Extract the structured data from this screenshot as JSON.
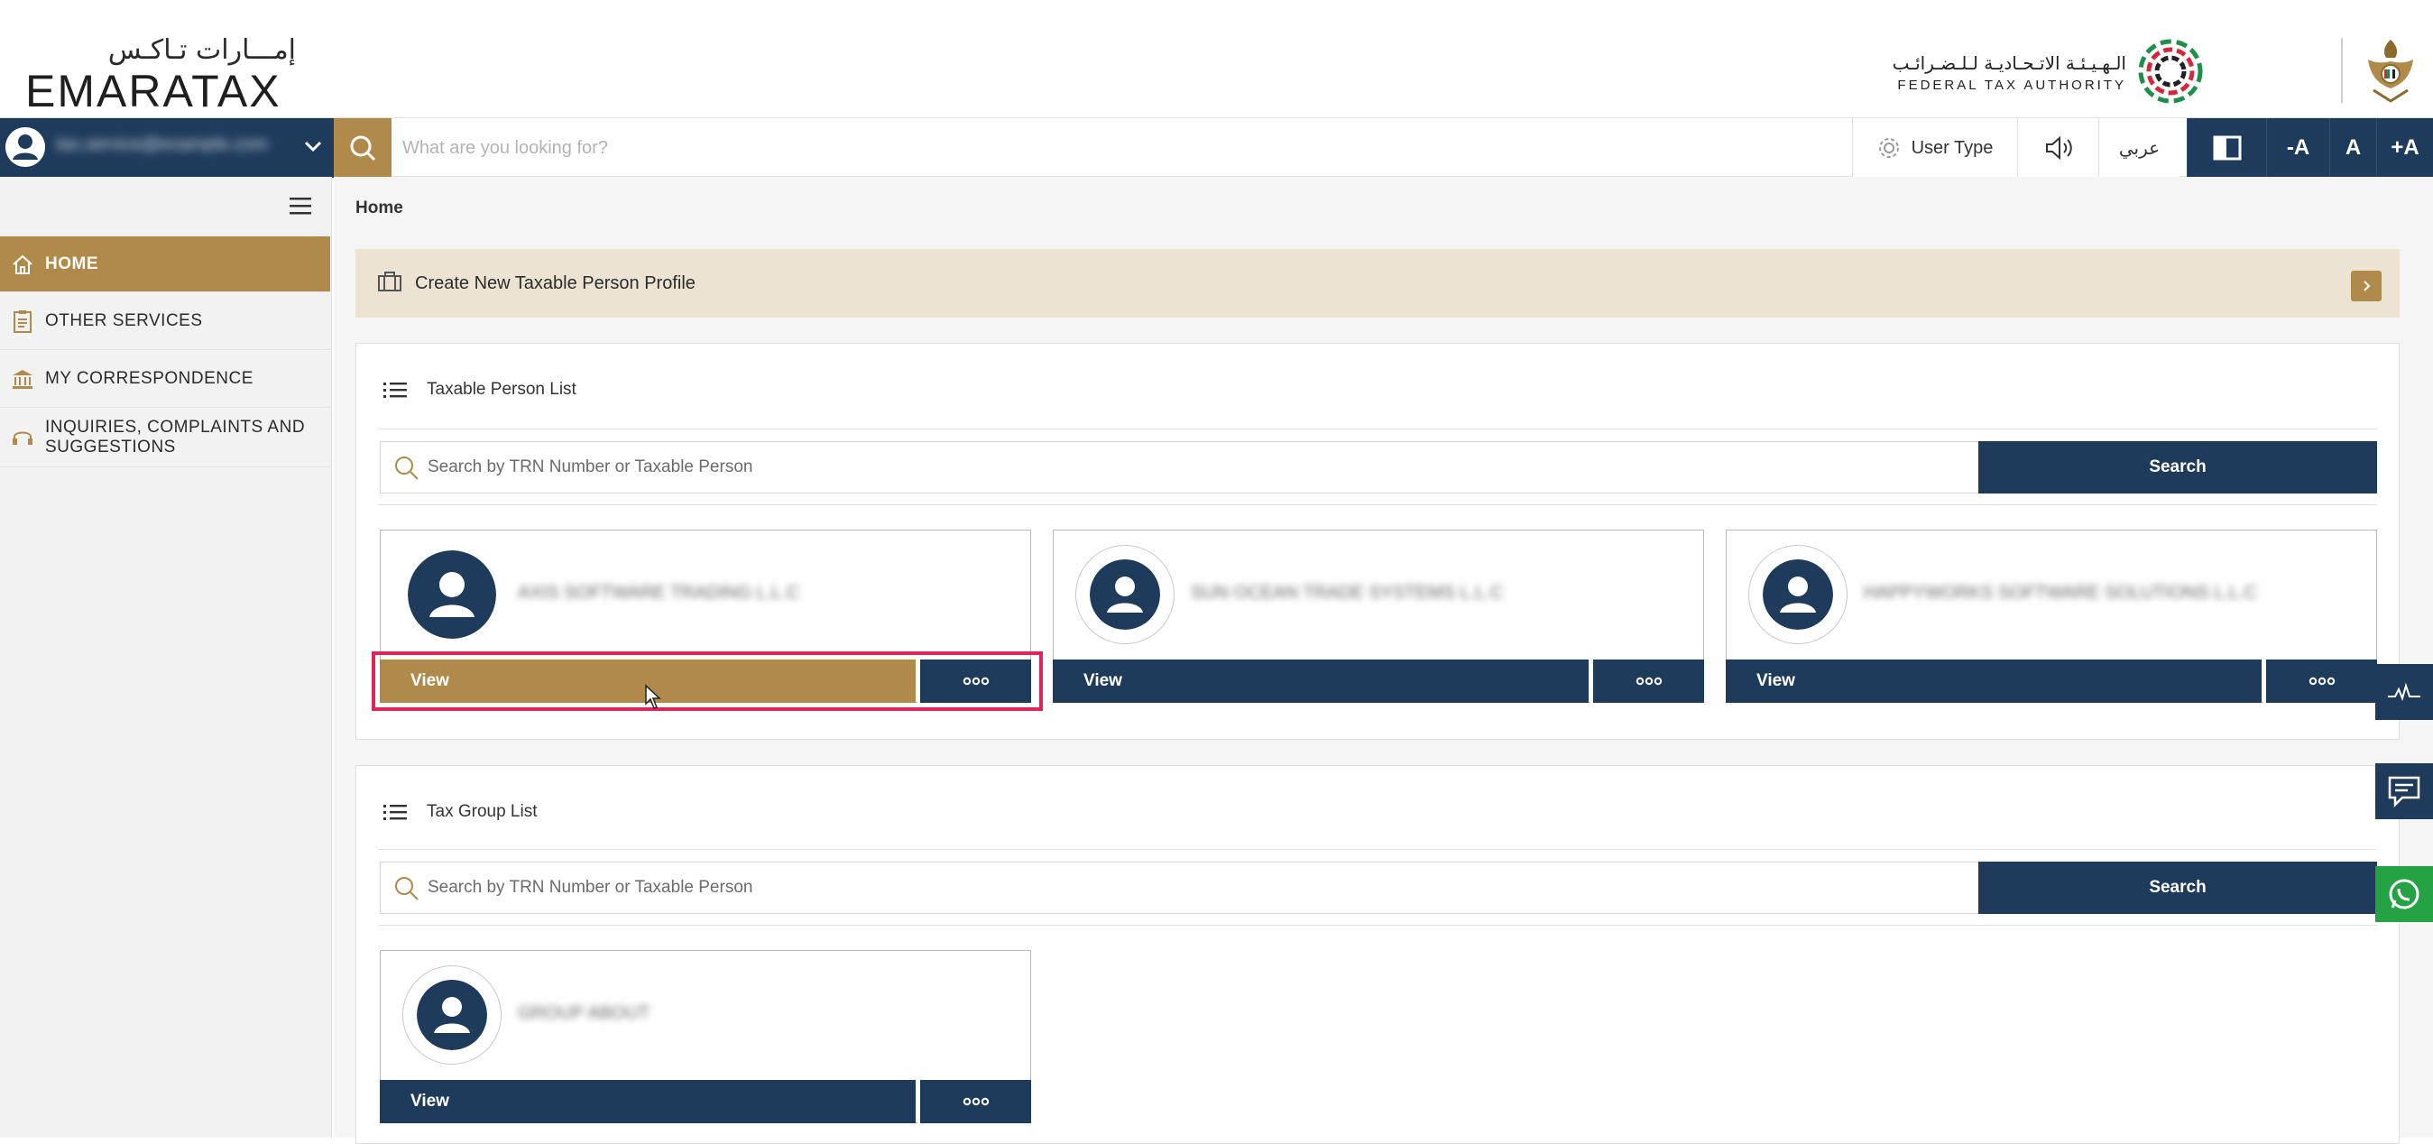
{
  "header": {
    "logo_ar": "إمـــارات تـاكـس",
    "logo_en": "EMARATAX",
    "authority_ar": "الـهـيـئـة الاتـحـاديـة لـلـضـرائـب",
    "authority_en": "FEDERAL TAX AUTHORITY"
  },
  "topbar": {
    "user_email": "tax.service@example.com",
    "search_placeholder": "What are you looking for?",
    "user_type": "User Type",
    "language": "عربي",
    "font_decrease": "-A",
    "font_default": "A",
    "font_increase": "+A"
  },
  "sidebar": {
    "items": [
      {
        "label": "HOME",
        "icon": "home-icon",
        "active": true
      },
      {
        "label": "OTHER SERVICES",
        "icon": "clipboard-icon",
        "active": false
      },
      {
        "label": "MY CORRESPONDENCE",
        "icon": "bank-icon",
        "active": false
      },
      {
        "label": "INQUIRIES, COMPLAINTS AND SUGGESTIONS",
        "icon": "headset-icon",
        "active": false
      }
    ]
  },
  "breadcrumb": "Home",
  "create_profile": {
    "label": "Create New Taxable Person Profile"
  },
  "taxable_person_list": {
    "title": "Taxable Person List",
    "search_placeholder": "Search by TRN Number or Taxable Person",
    "search_button": "Search",
    "cards": [
      {
        "name": "AXIS SOFTWARE TRADING L.L.C",
        "view": "View"
      },
      {
        "name": "SUN OCEAN TRADE SYSTEMS L.L.C",
        "view": "View"
      },
      {
        "name": "HAPPYWORKS SOFTWARE SOLUTIONS L.L.C",
        "view": "View"
      }
    ]
  },
  "tax_group_list": {
    "title": "Tax Group List",
    "search_placeholder": "Search by TRN Number or Taxable Person",
    "search_button": "Search",
    "cards": [
      {
        "name": "GROUP ABOUT",
        "view": "View"
      }
    ]
  },
  "colors": {
    "navy": "#1f3b5c",
    "gold": "#b08a4a",
    "banner": "#ede3d2",
    "highlight": "#e3245a",
    "whatsapp": "#25a244"
  }
}
